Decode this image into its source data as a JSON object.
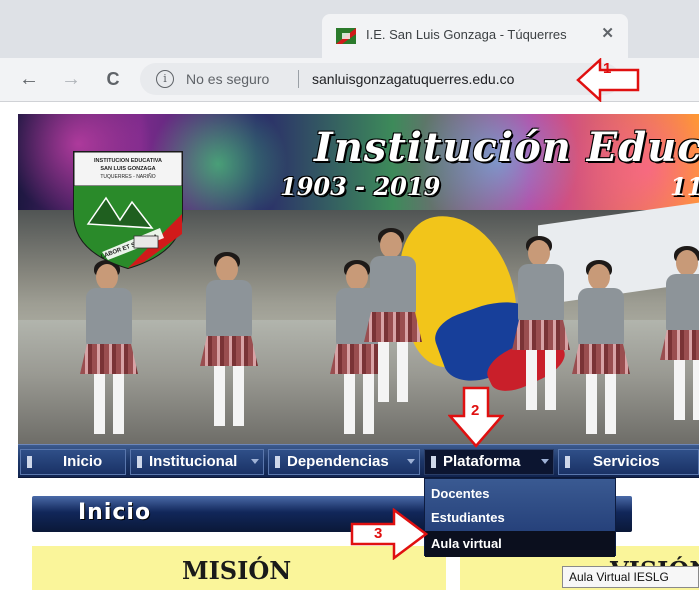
{
  "browser": {
    "tab_title": "I.E. San Luis Gonzaga - Túquerres",
    "tab_close": "✕",
    "back": "←",
    "forward": "→",
    "reload": "C",
    "info": "i",
    "security_text": "No es seguro",
    "url": "sanluisgonzagatuquerres.edu.co"
  },
  "banner": {
    "title": "Institución Educ",
    "years": "1903 - 2019",
    "side_text": "11",
    "shield_lines": [
      "INSTITUCION EDUCATIVA",
      "SAN LUIS GONZAGA",
      "TUQUERRES - NARIÑO"
    ],
    "shield_motto": "LABOR ET SCIENTIA"
  },
  "nav": {
    "items": [
      {
        "label": "Inicio"
      },
      {
        "label": "Institucional"
      },
      {
        "label": "Dependencias"
      },
      {
        "label": "Plataforma"
      },
      {
        "label": "Servicios"
      }
    ]
  },
  "dropdown": {
    "items": [
      "Docentes",
      "Estudiantes",
      "Aula virtual"
    ]
  },
  "content": {
    "section_title": "Inicio",
    "mision": "MISIÓN",
    "vision": "VISIÓN"
  },
  "tooltip": "Aula Virtual IESLG",
  "annotations": [
    "1",
    "2",
    "3"
  ],
  "colors": {
    "annotation": "#e01010",
    "nav_bar": "#1c3668",
    "mision_bg": "#faf59a"
  }
}
